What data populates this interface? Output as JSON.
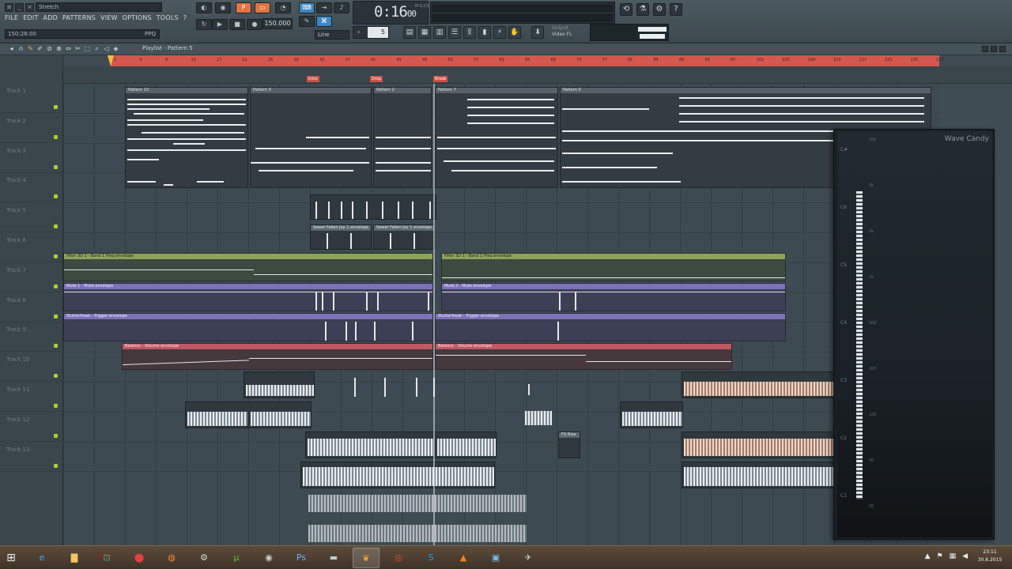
{
  "toolbar": {
    "hint": "Stretch",
    "menu": [
      "FILE",
      "EDIT",
      "ADD",
      "PATTERNS",
      "VIEW",
      "OPTIONS",
      "TOOLS",
      "?"
    ],
    "song_position": "150:28:00",
    "song_position_unit": "PPQ",
    "tempo": "150.000",
    "snap_value": "Line",
    "time": "0:16",
    "time_fraction": "00",
    "time_label": "M:S:CS",
    "pattern_number": "5",
    "output_label": "Output",
    "output_value": "Video FL"
  },
  "playlist": {
    "title": "Playlist - Pattern 5",
    "tracks": [
      "Track 1",
      "Track 2",
      "Track 3",
      "Track 4",
      "Track 5",
      "Track 6",
      "Track 7",
      "Track 8",
      "Track 9",
      "Track 10",
      "Track 11",
      "Track 12",
      "Track 13"
    ],
    "ruler_ticks": [
      "1",
      "5",
      "9",
      "13",
      "17",
      "21",
      "25",
      "29",
      "33",
      "37",
      "41",
      "45",
      "49",
      "53",
      "57",
      "61",
      "65",
      "69",
      "73",
      "77",
      "81",
      "85",
      "89",
      "93",
      "97",
      "101",
      "105",
      "109",
      "113",
      "117",
      "121",
      "125",
      "129"
    ],
    "markers": [
      "Intro",
      "Drop",
      "Break"
    ],
    "clips": {
      "pattern_a": "Pattern 13",
      "pattern_b": "Pattern 3",
      "pattern_c": "Pattern 2",
      "pattern_d": "Pattern 7",
      "pattern_e": "Pattern 5",
      "cutoff_a": "Sawer Fallen Joy 1 envelope",
      "cutoff_b": "Sawer Fallen Joy 1 envelope",
      "filter_a": "Filter 3D 1 - Band 1 Freq envelope",
      "filter_b": "Filter 3D 1 - Band 1 Freq envelope",
      "mute_a": "Mute 1 - Mute envelope",
      "mute_b": "Mute 2 - Mute envelope",
      "gate_a": "Stutterfreak - Trigger envelope",
      "gate_b": "Stutterfreak - Trigger envelope",
      "balance_a": "Balance - Volume envelope",
      "balance_b": "Balance - Volume envelope",
      "riser": "FX Rise"
    }
  },
  "wavecandy": {
    "title": "Wave Candy",
    "notes": [
      "C#",
      "C6",
      "C5",
      "C4",
      "C3",
      "C2",
      "C1"
    ],
    "hz": [
      "10k",
      "5k",
      "2k",
      "1k",
      "500",
      "200",
      "100",
      "50",
      "20"
    ]
  },
  "taskbar": {
    "icons": [
      "ie",
      "explorer",
      "app-green",
      "app-red",
      "app-firefox",
      "steam",
      "utorrent",
      "app-media",
      "photoshop",
      "app-gray",
      "fl-studio",
      "chrome",
      "skype",
      "vlc",
      "app-blue",
      "app-tools"
    ],
    "clock_time": "23:11",
    "clock_date": "30.6.2015"
  },
  "colors": {
    "loop_region": "#d4584f",
    "automation_green": "#8ea35a",
    "automation_purple": "#7c72b8",
    "automation_red": "#c05866",
    "accent_orange": "#e0743f"
  }
}
